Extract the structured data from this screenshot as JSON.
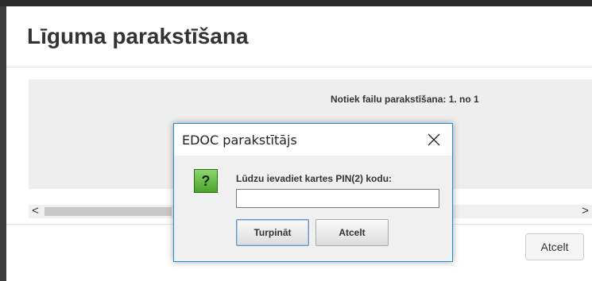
{
  "main": {
    "title": "Līguma parakstīšana",
    "progress_text": "Notiek failu parakstīšana:  1. no 1",
    "cancel_label": "Atcelt"
  },
  "scrollbar": {
    "left_arrow": "<",
    "right_arrow": ">"
  },
  "modal": {
    "title": "EDOC parakstītājs",
    "icon_glyph": "?",
    "prompt": "Lūdzu ievadiet kartes PIN(2) kodu:",
    "pin_value": "",
    "continue_label": "Turpināt",
    "cancel_label": "Atcelt"
  }
}
